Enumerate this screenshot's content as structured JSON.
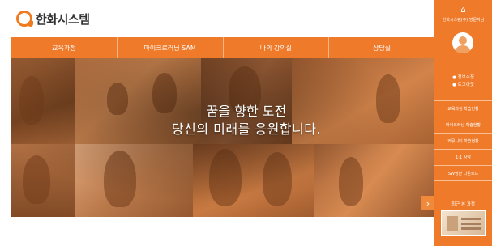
{
  "brand": {
    "logo_text": "한화시스템",
    "accent": "#ee7a2a"
  },
  "nav": {
    "items": [
      {
        "label": "교육과정"
      },
      {
        "label": "마이크로러닝 SAM"
      },
      {
        "label": "나의 강의실"
      },
      {
        "label": "상담실"
      }
    ]
  },
  "hero": {
    "title": "꿈을 향한 도전",
    "subtitle": "당신의 미래를 응원합니다.",
    "next_icon": "chevron-right-icon"
  },
  "sidebar": {
    "home_icon": "home-icon",
    "user_label": "한화시스템(주) 방문자님",
    "avatar_icon": "user-avatar-icon",
    "links": [
      {
        "label": "정보수정"
      },
      {
        "label": "로그아웃"
      }
    ],
    "menu": [
      {
        "label": "교육과정 학습현황"
      },
      {
        "label": "마이크러닝 학습현황"
      },
      {
        "label": "커뮤니티 학습현황"
      },
      {
        "label": "1:1 상담"
      },
      {
        "label": "SW명단 다운로드"
      }
    ],
    "recent_label": "최근 본 과정"
  }
}
